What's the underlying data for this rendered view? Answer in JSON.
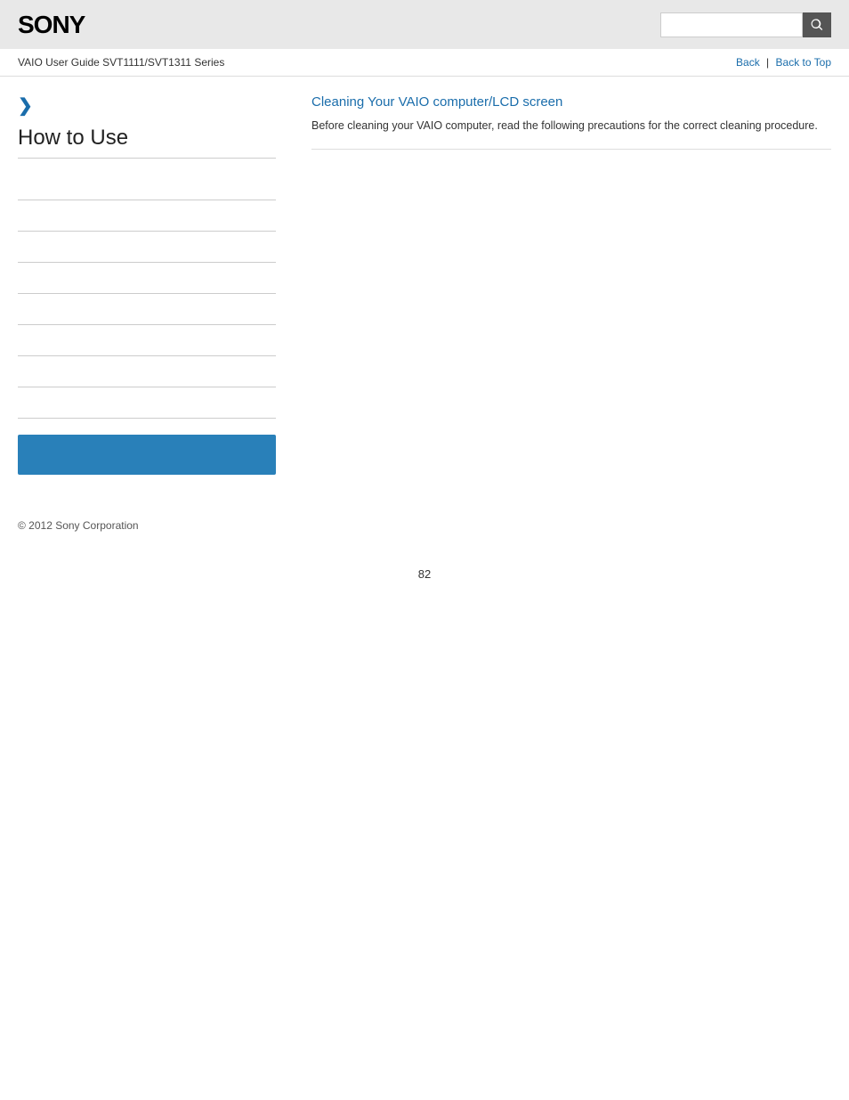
{
  "header": {
    "logo": "SONY",
    "search_placeholder": ""
  },
  "nav": {
    "guide_title": "VAIO User Guide SVT1111/SVT1311 Series",
    "back_label": "Back",
    "back_to_top_label": "Back to Top",
    "separator": "|"
  },
  "sidebar": {
    "chevron": "❯",
    "title": "How to Use",
    "items": [
      {
        "label": ""
      },
      {
        "label": ""
      },
      {
        "label": ""
      },
      {
        "label": ""
      },
      {
        "label": ""
      },
      {
        "label": ""
      },
      {
        "label": ""
      },
      {
        "label": ""
      }
    ]
  },
  "content": {
    "article_title": "Cleaning Your VAIO computer/LCD screen",
    "article_description": "Before cleaning your VAIO computer, read the following precautions for the correct cleaning procedure."
  },
  "footer": {
    "copyright": "© 2012 Sony Corporation"
  },
  "page": {
    "number": "82"
  },
  "colors": {
    "link": "#1a6dab",
    "blue_bar": "#2980b9",
    "border": "#ccc"
  }
}
